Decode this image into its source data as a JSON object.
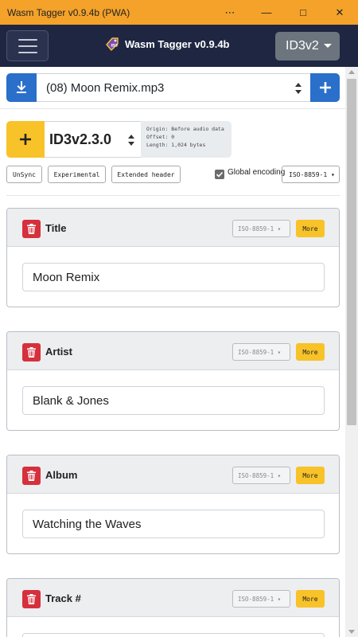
{
  "window": {
    "title": "Wasm Tagger v0.9.4b (PWA)",
    "controls": [
      "⋯",
      "—",
      "□",
      "✕"
    ]
  },
  "navbar": {
    "brand": "Wasm Tagger v0.9.4b",
    "tag_select": "ID3v2"
  },
  "file": {
    "selected": "(08) Moon Remix.mp3"
  },
  "tag": {
    "version": "ID3v2.3.0",
    "info": [
      "Origin: Before audio data",
      "Offset: 0",
      "Length: 1,024 bytes"
    ],
    "flags": [
      "UnSync",
      "Experimental",
      "Extended header"
    ],
    "global_encoding_label": "Global encoding",
    "global_encoding_checked": true,
    "global_encoding": "ISO-8859-1 ▾"
  },
  "frames": [
    {
      "title": "Title",
      "encoding": "ISO-8859-1 ▾",
      "more": "More",
      "value": "Moon Remix"
    },
    {
      "title": "Artist",
      "encoding": "ISO-8859-1 ▾",
      "more": "More",
      "value": "Blank & Jones"
    },
    {
      "title": "Album",
      "encoding": "ISO-8859-1 ▾",
      "more": "More",
      "value": "Watching the Waves"
    },
    {
      "title": "Track #",
      "encoding": "ISO-8859-1 ▾",
      "more": "More",
      "value": ""
    }
  ],
  "colors": {
    "titlebar": "#f4a22a",
    "navbar": "#1e2641",
    "primary": "#2a6fca",
    "warning": "#f8c229",
    "danger": "#d6303d"
  }
}
